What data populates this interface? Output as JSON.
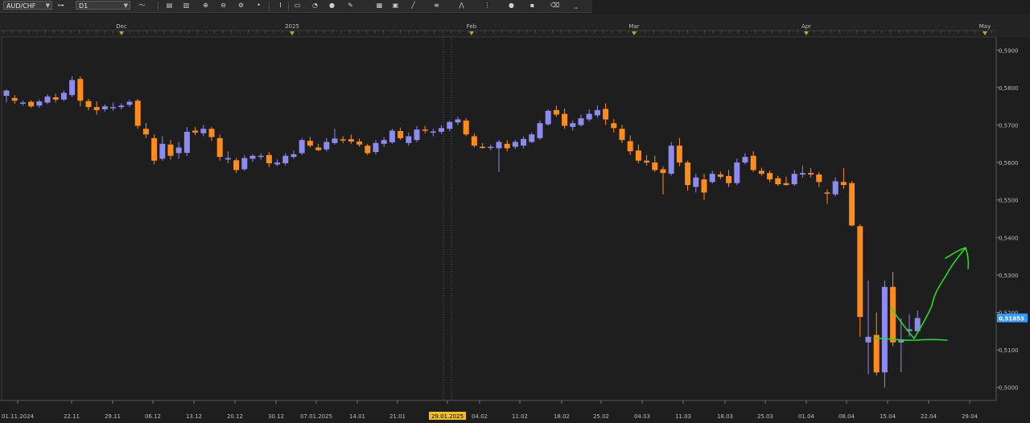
{
  "toolbar": {
    "symbol": "AUD/CHF",
    "timeframe": "D1",
    "icons": [
      "chart-type-icon",
      "link-icon",
      "indicators-icon",
      "bar-chart-icon",
      "candles-icon",
      "zoom-in-icon",
      "zoom-out-icon",
      "dot-icon",
      "cursor-icon",
      "note-icon",
      "drawing-icon",
      "sphere-icon",
      "pencil-icon",
      "signal-icon",
      "grid-icon",
      "line-icon",
      "channel-icon",
      "fork-icon",
      "circle-icon",
      "options-icon",
      "eraser-icon",
      "levels-icon"
    ]
  },
  "colors": {
    "bullish": "#8b8bf0",
    "bearish": "#ff8c1a",
    "background": "#1e1e1e",
    "grid": "#3a3a3a",
    "axis_text": "#bdbdbd",
    "month_marker": "#c9a227",
    "price_marker": "#3399ff",
    "date_marker": "#f0c020",
    "annotation": "#22dd22"
  },
  "chart_data": {
    "type": "candlestick",
    "symbol": "AUD/CHF",
    "timeframe": "D1",
    "ylim": [
      0.4965,
      0.5935
    ],
    "y_ticks": [
      "0,5900",
      "0,5800",
      "0,5700",
      "0,5600",
      "0,5500",
      "0,5400",
      "0,5300",
      "0,5200",
      "0,5100",
      "0,5000"
    ],
    "top_axis_labels": [
      "Dec",
      "2025",
      "Feb",
      "Mar",
      "Apr",
      "May"
    ],
    "x_tick_labels": [
      "01.11.2024",
      "22.11",
      "29.11",
      "06.12",
      "13.12",
      "20.12",
      "30.12",
      "07.01.2025",
      "14.01",
      "21.01",
      "29.01.2025",
      "04.02",
      "11.02",
      "18.02",
      "25.02",
      "04.03",
      "11.03",
      "18.03",
      "25.03",
      "01.04",
      "08.04",
      "15.04",
      "22.04",
      "29.04"
    ],
    "highlighted_date": "29.01.2025",
    "last_price": "0,51853",
    "grid": false,
    "candles": [
      {
        "o": 0.5778,
        "h": 0.5795,
        "l": 0.576,
        "c": 0.5792
      },
      {
        "o": 0.5772,
        "h": 0.578,
        "l": 0.5757,
        "c": 0.5765
      },
      {
        "o": 0.5758,
        "h": 0.5766,
        "l": 0.5752,
        "c": 0.576
      },
      {
        "o": 0.5762,
        "h": 0.5766,
        "l": 0.5746,
        "c": 0.575
      },
      {
        "o": 0.5752,
        "h": 0.5768,
        "l": 0.5746,
        "c": 0.5763
      },
      {
        "o": 0.576,
        "h": 0.5782,
        "l": 0.5756,
        "c": 0.5776
      },
      {
        "o": 0.5774,
        "h": 0.5784,
        "l": 0.576,
        "c": 0.5768
      },
      {
        "o": 0.5768,
        "h": 0.5792,
        "l": 0.5764,
        "c": 0.5786
      },
      {
        "o": 0.578,
        "h": 0.583,
        "l": 0.5775,
        "c": 0.582
      },
      {
        "o": 0.5823,
        "h": 0.583,
        "l": 0.575,
        "c": 0.5765
      },
      {
        "o": 0.5764,
        "h": 0.577,
        "l": 0.574,
        "c": 0.5748
      },
      {
        "o": 0.5748,
        "h": 0.5763,
        "l": 0.5728,
        "c": 0.574
      },
      {
        "o": 0.5742,
        "h": 0.5755,
        "l": 0.5736,
        "c": 0.575
      },
      {
        "o": 0.5745,
        "h": 0.576,
        "l": 0.5738,
        "c": 0.5748
      },
      {
        "o": 0.5748,
        "h": 0.5758,
        "l": 0.5742,
        "c": 0.5752
      },
      {
        "o": 0.5754,
        "h": 0.5768,
        "l": 0.5748,
        "c": 0.5762
      },
      {
        "o": 0.5765,
        "h": 0.577,
        "l": 0.569,
        "c": 0.5698
      },
      {
        "o": 0.569,
        "h": 0.5705,
        "l": 0.5665,
        "c": 0.5675
      },
      {
        "o": 0.5665,
        "h": 0.5675,
        "l": 0.5595,
        "c": 0.5605
      },
      {
        "o": 0.561,
        "h": 0.567,
        "l": 0.5605,
        "c": 0.565
      },
      {
        "o": 0.5648,
        "h": 0.566,
        "l": 0.5608,
        "c": 0.5618
      },
      {
        "o": 0.5625,
        "h": 0.5655,
        "l": 0.561,
        "c": 0.564
      },
      {
        "o": 0.5626,
        "h": 0.5695,
        "l": 0.5618,
        "c": 0.5682
      },
      {
        "o": 0.5685,
        "h": 0.5695,
        "l": 0.5673,
        "c": 0.568
      },
      {
        "o": 0.5678,
        "h": 0.57,
        "l": 0.567,
        "c": 0.569
      },
      {
        "o": 0.569,
        "h": 0.5695,
        "l": 0.5658,
        "c": 0.5668
      },
      {
        "o": 0.5665,
        "h": 0.5675,
        "l": 0.5605,
        "c": 0.5615
      },
      {
        "o": 0.5608,
        "h": 0.563,
        "l": 0.5598,
        "c": 0.5612
      },
      {
        "o": 0.5606,
        "h": 0.5612,
        "l": 0.5572,
        "c": 0.558
      },
      {
        "o": 0.5582,
        "h": 0.562,
        "l": 0.5578,
        "c": 0.5612
      },
      {
        "o": 0.561,
        "h": 0.5622,
        "l": 0.5602,
        "c": 0.5618
      },
      {
        "o": 0.5615,
        "h": 0.5625,
        "l": 0.5608,
        "c": 0.5618
      },
      {
        "o": 0.562,
        "h": 0.5628,
        "l": 0.5588,
        "c": 0.5598
      },
      {
        "o": 0.5595,
        "h": 0.5608,
        "l": 0.559,
        "c": 0.56
      },
      {
        "o": 0.5598,
        "h": 0.5625,
        "l": 0.5592,
        "c": 0.5618
      },
      {
        "o": 0.5615,
        "h": 0.5632,
        "l": 0.561,
        "c": 0.5622
      },
      {
        "o": 0.5625,
        "h": 0.5665,
        "l": 0.562,
        "c": 0.566
      },
      {
        "o": 0.5658,
        "h": 0.5668,
        "l": 0.564,
        "c": 0.5645
      },
      {
        "o": 0.564,
        "h": 0.565,
        "l": 0.563,
        "c": 0.5633
      },
      {
        "o": 0.5635,
        "h": 0.5665,
        "l": 0.563,
        "c": 0.5655
      },
      {
        "o": 0.5652,
        "h": 0.569,
        "l": 0.5648,
        "c": 0.5664
      },
      {
        "o": 0.5662,
        "h": 0.567,
        "l": 0.5652,
        "c": 0.566
      },
      {
        "o": 0.5662,
        "h": 0.5674,
        "l": 0.565,
        "c": 0.5656
      },
      {
        "o": 0.5656,
        "h": 0.5664,
        "l": 0.5642,
        "c": 0.5648
      },
      {
        "o": 0.5645,
        "h": 0.565,
        "l": 0.562,
        "c": 0.5625
      },
      {
        "o": 0.5628,
        "h": 0.566,
        "l": 0.5622,
        "c": 0.5652
      },
      {
        "o": 0.565,
        "h": 0.5668,
        "l": 0.5642,
        "c": 0.566
      },
      {
        "o": 0.5654,
        "h": 0.569,
        "l": 0.565,
        "c": 0.5685
      },
      {
        "o": 0.5684,
        "h": 0.5693,
        "l": 0.566,
        "c": 0.5665
      },
      {
        "o": 0.5652,
        "h": 0.568,
        "l": 0.5645,
        "c": 0.567
      },
      {
        "o": 0.566,
        "h": 0.5697,
        "l": 0.5655,
        "c": 0.5688
      },
      {
        "o": 0.5688,
        "h": 0.5698,
        "l": 0.5678,
        "c": 0.5685
      },
      {
        "o": 0.568,
        "h": 0.569,
        "l": 0.567,
        "c": 0.5683
      },
      {
        "o": 0.5682,
        "h": 0.57,
        "l": 0.5676,
        "c": 0.5692
      },
      {
        "o": 0.569,
        "h": 0.5712,
        "l": 0.5684,
        "c": 0.5708
      },
      {
        "o": 0.5707,
        "h": 0.5722,
        "l": 0.57,
        "c": 0.5715
      },
      {
        "o": 0.5712,
        "h": 0.5718,
        "l": 0.567,
        "c": 0.5675
      },
      {
        "o": 0.567,
        "h": 0.5678,
        "l": 0.564,
        "c": 0.5645
      },
      {
        "o": 0.5642,
        "h": 0.5652,
        "l": 0.5637,
        "c": 0.564
      },
      {
        "o": 0.564,
        "h": 0.5648,
        "l": 0.5632,
        "c": 0.5642
      },
      {
        "o": 0.5638,
        "h": 0.566,
        "l": 0.5575,
        "c": 0.5655
      },
      {
        "o": 0.565,
        "h": 0.566,
        "l": 0.563,
        "c": 0.5638
      },
      {
        "o": 0.5642,
        "h": 0.566,
        "l": 0.5636,
        "c": 0.5655
      },
      {
        "o": 0.5645,
        "h": 0.567,
        "l": 0.5638,
        "c": 0.5663
      },
      {
        "o": 0.5655,
        "h": 0.568,
        "l": 0.5652,
        "c": 0.5675
      },
      {
        "o": 0.5665,
        "h": 0.5712,
        "l": 0.566,
        "c": 0.5705
      },
      {
        "o": 0.5702,
        "h": 0.5742,
        "l": 0.5698,
        "c": 0.5738
      },
      {
        "o": 0.574,
        "h": 0.5752,
        "l": 0.5722,
        "c": 0.5728
      },
      {
        "o": 0.573,
        "h": 0.5744,
        "l": 0.569,
        "c": 0.5698
      },
      {
        "o": 0.5695,
        "h": 0.5712,
        "l": 0.5685,
        "c": 0.5705
      },
      {
        "o": 0.57,
        "h": 0.5728,
        "l": 0.5696,
        "c": 0.5718
      },
      {
        "o": 0.5715,
        "h": 0.5742,
        "l": 0.571,
        "c": 0.573
      },
      {
        "o": 0.5726,
        "h": 0.5752,
        "l": 0.572,
        "c": 0.574
      },
      {
        "o": 0.5743,
        "h": 0.5758,
        "l": 0.57,
        "c": 0.5715
      },
      {
        "o": 0.5705,
        "h": 0.5716,
        "l": 0.568,
        "c": 0.5692
      },
      {
        "o": 0.569,
        "h": 0.57,
        "l": 0.5652,
        "c": 0.566
      },
      {
        "o": 0.5657,
        "h": 0.5672,
        "l": 0.562,
        "c": 0.563
      },
      {
        "o": 0.5632,
        "h": 0.5648,
        "l": 0.5598,
        "c": 0.5605
      },
      {
        "o": 0.5605,
        "h": 0.562,
        "l": 0.5592,
        "c": 0.56
      },
      {
        "o": 0.56,
        "h": 0.5618,
        "l": 0.5575,
        "c": 0.558
      },
      {
        "o": 0.5582,
        "h": 0.559,
        "l": 0.5515,
        "c": 0.5572
      },
      {
        "o": 0.557,
        "h": 0.5655,
        "l": 0.5565,
        "c": 0.5645
      },
      {
        "o": 0.5645,
        "h": 0.5665,
        "l": 0.559,
        "c": 0.56
      },
      {
        "o": 0.56,
        "h": 0.5605,
        "l": 0.5525,
        "c": 0.554
      },
      {
        "o": 0.5535,
        "h": 0.557,
        "l": 0.552,
        "c": 0.556
      },
      {
        "o": 0.5555,
        "h": 0.557,
        "l": 0.55,
        "c": 0.552
      },
      {
        "o": 0.5548,
        "h": 0.5578,
        "l": 0.5544,
        "c": 0.557
      },
      {
        "o": 0.5568,
        "h": 0.5576,
        "l": 0.5556,
        "c": 0.5562
      },
      {
        "o": 0.5564,
        "h": 0.558,
        "l": 0.5535,
        "c": 0.5545
      },
      {
        "o": 0.5545,
        "h": 0.561,
        "l": 0.554,
        "c": 0.56
      },
      {
        "o": 0.56,
        "h": 0.5625,
        "l": 0.5595,
        "c": 0.5615
      },
      {
        "o": 0.5618,
        "h": 0.563,
        "l": 0.5575,
        "c": 0.558
      },
      {
        "o": 0.5578,
        "h": 0.5586,
        "l": 0.5565,
        "c": 0.557
      },
      {
        "o": 0.5572,
        "h": 0.5578,
        "l": 0.5548,
        "c": 0.5555
      },
      {
        "o": 0.5558,
        "h": 0.5565,
        "l": 0.5538,
        "c": 0.5542
      },
      {
        "o": 0.5545,
        "h": 0.5562,
        "l": 0.5538,
        "c": 0.554
      },
      {
        "o": 0.5542,
        "h": 0.558,
        "l": 0.5538,
        "c": 0.557
      },
      {
        "o": 0.5568,
        "h": 0.5592,
        "l": 0.556,
        "c": 0.5572
      },
      {
        "o": 0.5572,
        "h": 0.5585,
        "l": 0.556,
        "c": 0.5568
      },
      {
        "o": 0.5568,
        "h": 0.5575,
        "l": 0.5535,
        "c": 0.5548
      },
      {
        "o": 0.552,
        "h": 0.5528,
        "l": 0.549,
        "c": 0.5518
      },
      {
        "o": 0.5515,
        "h": 0.556,
        "l": 0.551,
        "c": 0.555
      },
      {
        "o": 0.5548,
        "h": 0.5585,
        "l": 0.553,
        "c": 0.554
      },
      {
        "o": 0.5545,
        "h": 0.555,
        "l": 0.543,
        "c": 0.5432
      },
      {
        "o": 0.543,
        "h": 0.5435,
        "l": 0.5135,
        "c": 0.5188
      },
      {
        "o": 0.512,
        "h": 0.5285,
        "l": 0.5035,
        "c": 0.5135
      },
      {
        "o": 0.514,
        "h": 0.52,
        "l": 0.5032,
        "c": 0.504
      },
      {
        "o": 0.504,
        "h": 0.5285,
        "l": 0.5,
        "c": 0.5268
      },
      {
        "o": 0.5268,
        "h": 0.5308,
        "l": 0.511,
        "c": 0.512
      },
      {
        "o": 0.512,
        "h": 0.5185,
        "l": 0.504,
        "c": 0.5125
      },
      {
        "o": 0.515,
        "h": 0.5195,
        "l": 0.5135,
        "c": 0.5155
      },
      {
        "o": 0.515,
        "h": 0.5205,
        "l": 0.5145,
        "c": 0.5185
      }
    ]
  }
}
